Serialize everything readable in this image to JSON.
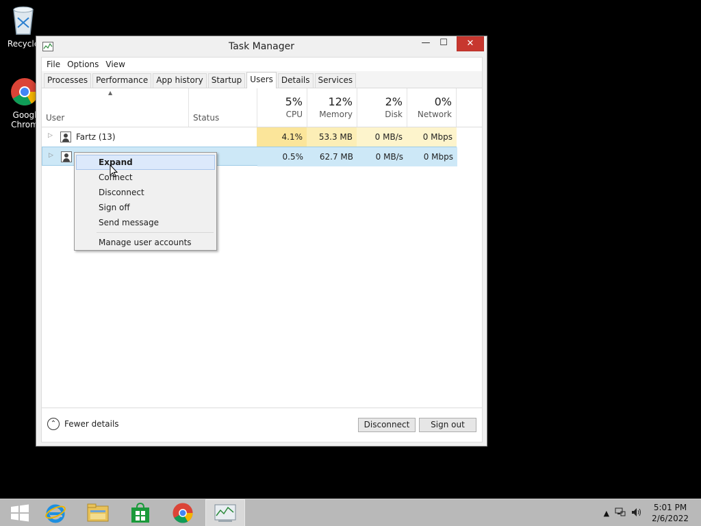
{
  "desktop": {
    "icons": [
      {
        "label": "Recycle"
      },
      {
        "label": "Googl\nChrom"
      }
    ]
  },
  "window": {
    "title": "Task Manager",
    "controls": {
      "minimize": "—",
      "maximize": "☐",
      "close": "✕"
    }
  },
  "menu": [
    "File",
    "Options",
    "View"
  ],
  "tabs": [
    {
      "label": "Processes",
      "active": false
    },
    {
      "label": "Performance",
      "active": false
    },
    {
      "label": "App history",
      "active": false
    },
    {
      "label": "Startup",
      "active": false
    },
    {
      "label": "Users",
      "active": true
    },
    {
      "label": "Details",
      "active": false
    },
    {
      "label": "Services",
      "active": false
    }
  ],
  "columns": {
    "user": "User",
    "status": "Status",
    "cpu": {
      "pct": "5%",
      "label": "CPU"
    },
    "memory": {
      "pct": "12%",
      "label": "Memory"
    },
    "disk": {
      "pct": "2%",
      "label": "Disk"
    },
    "network": {
      "pct": "0%",
      "label": "Network"
    }
  },
  "rows": [
    {
      "user": "Fartz (13)",
      "status": "",
      "cpu": "4.1%",
      "memory": "53.3 MB",
      "disk": "0 MB/s",
      "network": "0 Mbps"
    },
    {
      "user": "",
      "status": "",
      "cpu": "0.5%",
      "memory": "62.7 MB",
      "disk": "0 MB/s",
      "network": "0 Mbps"
    }
  ],
  "context_menu": {
    "items": [
      "Expand",
      "Connect",
      "Disconnect",
      "Sign off",
      "Send message"
    ],
    "footer_item": "Manage user accounts"
  },
  "footer": {
    "fewer_details": "Fewer details",
    "disconnect": "Disconnect",
    "sign_out": "Sign out"
  },
  "taskbar": {
    "time": "5:01 PM",
    "date": "2/6/2022"
  }
}
